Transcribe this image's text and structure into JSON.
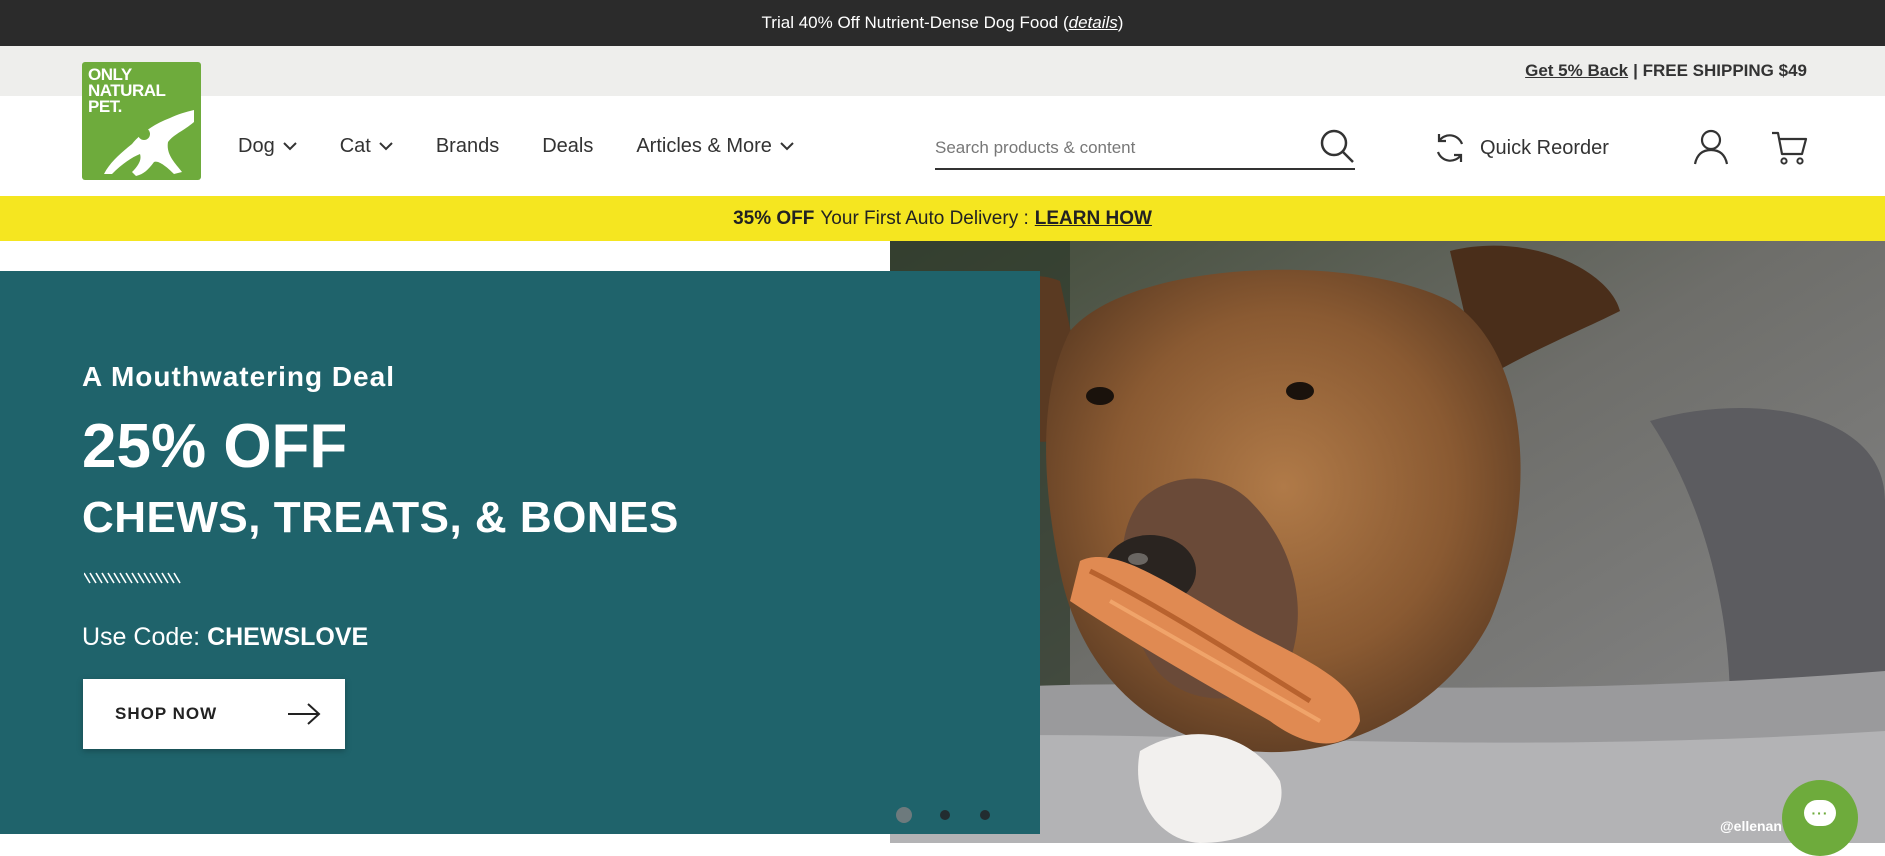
{
  "topbar": {
    "text": "Trial 40% Off Nutrient-Dense Dog Food (",
    "link": "details",
    "suffix": ")"
  },
  "utility": {
    "cashback_link": "Get 5% Back",
    "shipping_text": "| FREE SHIPPING $49"
  },
  "logo": {
    "text_line1": "ONLY",
    "text_line2": "NATURAL",
    "text_line3": "PET."
  },
  "nav": {
    "items": [
      {
        "label": "Dog",
        "has_dropdown": true
      },
      {
        "label": "Cat",
        "has_dropdown": true
      },
      {
        "label": "Brands",
        "has_dropdown": false
      },
      {
        "label": "Deals",
        "has_dropdown": false
      },
      {
        "label": "Articles & More",
        "has_dropdown": true
      }
    ]
  },
  "search": {
    "placeholder": "Search products & content",
    "icon": "search-icon"
  },
  "quick_reorder": {
    "label": "Quick Reorder",
    "icon": "refresh-icon"
  },
  "icons": {
    "account": "user-icon",
    "cart": "cart-icon"
  },
  "promo": {
    "bold": "35% OFF",
    "text": "Your First Auto Delivery :",
    "link": "LEARN HOW"
  },
  "hero": {
    "eyebrow": "A Mouthwatering Deal",
    "headline": "25% OFF",
    "subheadline": "CHEWS, TREATS, & BONES",
    "code_label": "Use Code:",
    "code_value": "CHEWSLOVE",
    "cta": "SHOP NOW",
    "photo_credit": "@ellenan",
    "slides": 3,
    "active_slide": 1
  },
  "colors": {
    "topbar": "#2b2b2b",
    "brand_green": "#6eab3c",
    "promo_yellow": "#f5e620",
    "hero_teal": "#1f636b"
  }
}
